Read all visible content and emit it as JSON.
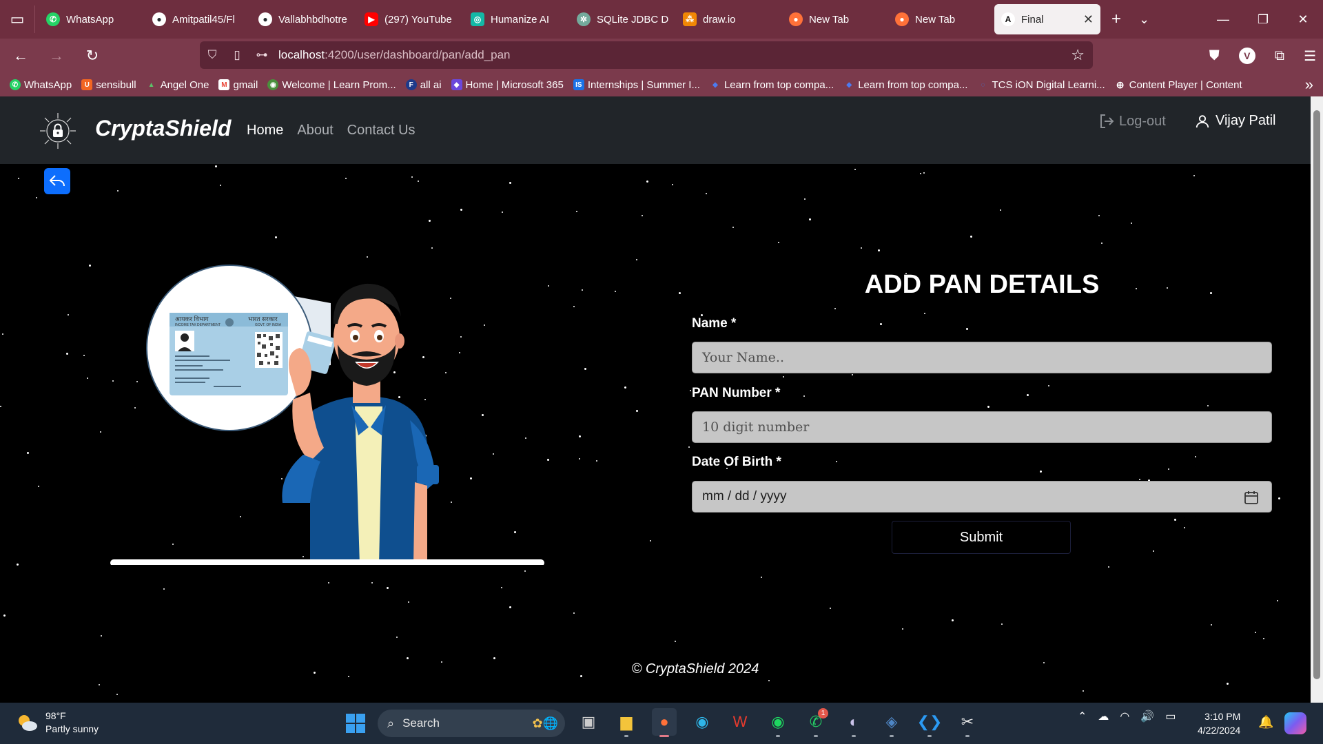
{
  "browser": {
    "tabs": [
      {
        "label": "WhatsApp",
        "icon": "whatsapp-icon",
        "color": "#25d366"
      },
      {
        "label": "Amitpatil45/Fl",
        "icon": "github-icon",
        "color": "#24292e"
      },
      {
        "label": "Vallabhbdhotre",
        "icon": "github-icon",
        "color": "#24292e"
      },
      {
        "label": "(297) YouTube",
        "icon": "youtube-icon",
        "color": "#ff0000"
      },
      {
        "label": "Humanize AI",
        "icon": "humanize-icon",
        "color": "#14b8a6"
      },
      {
        "label": "SQLite JDBC Dr",
        "icon": "openai-icon",
        "color": "#74aa9c"
      },
      {
        "label": "draw.io",
        "icon": "drawio-icon",
        "color": "#f08705"
      },
      {
        "label": "New Tab",
        "icon": "firefox-icon",
        "color": "#ff7139"
      },
      {
        "label": "New Tab",
        "icon": "firefox-icon",
        "color": "#ff7139"
      },
      {
        "label": "Final",
        "icon": "angular-icon",
        "color": "#dd0031",
        "active": true
      }
    ],
    "url_host": "localhost",
    "url_path": ":4200/user/dashboard/pan/add_pan",
    "profile_initial": "V",
    "bookmarks": [
      {
        "label": "WhatsApp",
        "color": "#25d366"
      },
      {
        "label": "sensibull",
        "color": "#f26522"
      },
      {
        "label": "Angel One",
        "color": "#2e7d32"
      },
      {
        "label": "gmail",
        "color": "#ea4335"
      },
      {
        "label": "Welcome | Learn Prom...",
        "color": "#4a8f3c"
      },
      {
        "label": "all ai",
        "color": "#1e3a8a"
      },
      {
        "label": "Home | Microsoft 365",
        "color": "#6b47dc"
      },
      {
        "label": "Internships | Summer I...",
        "color": "#1a73e8"
      },
      {
        "label": "Learn from top compa...",
        "color": "#2f4da8"
      },
      {
        "label": "Learn from top compa...",
        "color": "#2f4da8"
      },
      {
        "label": "TCS iON Digital Learni...",
        "color": "#1e63c8"
      },
      {
        "label": "Content Player | Content",
        "color": "#555555"
      }
    ]
  },
  "site": {
    "brand": "CryptaShield",
    "nav": [
      "Home",
      "About",
      "Contact Us"
    ],
    "logout": "Log-out",
    "user": "Vijay Patil"
  },
  "form": {
    "title": "ADD PAN DETAILS",
    "name_label": "Name *",
    "name_placeholder": "Your Name..",
    "pan_label": "PAN Number *",
    "pan_placeholder": "10 digit number",
    "dob_label": "Date Of Birth *",
    "dob_placeholder": "mm / dd / yyyy",
    "submit": "Submit"
  },
  "card": {
    "hindi_left": "आयकर विभाग",
    "hindi_right": "भारत सरकार",
    "dept": "INCOME TAX DEPARTMENT",
    "govt": "GOVT. OF INDIA"
  },
  "footer": "© CryptaShield 2024",
  "taskbar": {
    "temp": "98°F",
    "weather": "Partly sunny",
    "search": "Search",
    "time": "3:10 PM",
    "date": "4/22/2024",
    "whatsapp_badge": "1"
  }
}
